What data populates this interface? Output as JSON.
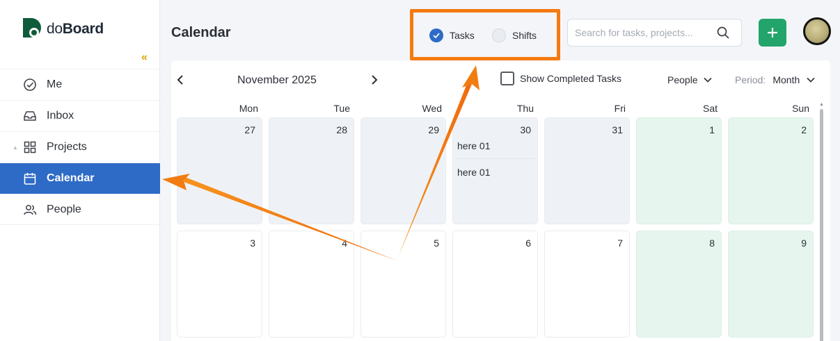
{
  "app": {
    "logo_prefix": "do",
    "logo_suffix": "Board",
    "collapse_glyph": "«"
  },
  "sidebar": {
    "items": [
      {
        "label": "Me",
        "icon": "check-circle-icon",
        "active": false
      },
      {
        "label": "Inbox",
        "icon": "inbox-icon",
        "active": false
      },
      {
        "label": "Projects",
        "icon": "grid-icon",
        "active": false
      },
      {
        "label": "Calendar",
        "icon": "calendar-icon",
        "active": true
      },
      {
        "label": "People",
        "icon": "people-icon",
        "active": false
      }
    ]
  },
  "header": {
    "title": "Calendar",
    "toggle": {
      "tasks_label": "Tasks",
      "tasks_checked": true,
      "shifts_label": "Shifts",
      "shifts_checked": false
    },
    "search": {
      "placeholder": "Search for tasks, projects...",
      "value": ""
    },
    "add_button": "+"
  },
  "calendar": {
    "month_label": "November 2025",
    "show_completed_label": "Show Completed Tasks",
    "show_completed_checked": false,
    "group_by": "People",
    "period_label": "Period:",
    "period_value": "Month",
    "weekdays": [
      "Mon",
      "Tue",
      "Wed",
      "Thu",
      "Fri",
      "Sat",
      "Sun"
    ],
    "weeks": [
      [
        {
          "day": "27",
          "kind": "past",
          "tasks": []
        },
        {
          "day": "28",
          "kind": "past",
          "tasks": []
        },
        {
          "day": "29",
          "kind": "past",
          "tasks": []
        },
        {
          "day": "30",
          "kind": "past",
          "tasks": [
            "here 01",
            "here 01"
          ]
        },
        {
          "day": "31",
          "kind": "past",
          "tasks": []
        },
        {
          "day": "1",
          "kind": "weekend",
          "tasks": []
        },
        {
          "day": "2",
          "kind": "weekend",
          "tasks": []
        }
      ],
      [
        {
          "day": "3",
          "kind": "current",
          "tasks": []
        },
        {
          "day": "4",
          "kind": "current",
          "tasks": []
        },
        {
          "day": "5",
          "kind": "current",
          "tasks": []
        },
        {
          "day": "6",
          "kind": "current",
          "tasks": []
        },
        {
          "day": "7",
          "kind": "current",
          "tasks": []
        },
        {
          "day": "8",
          "kind": "weekend",
          "tasks": []
        },
        {
          "day": "9",
          "kind": "weekend",
          "tasks": []
        }
      ]
    ]
  },
  "colors": {
    "accent": "#2e6bc6",
    "add_button": "#23a46a",
    "highlight_box": "#f47a12",
    "weekend": "#e6f6ee",
    "collapse": "#e0a400"
  }
}
